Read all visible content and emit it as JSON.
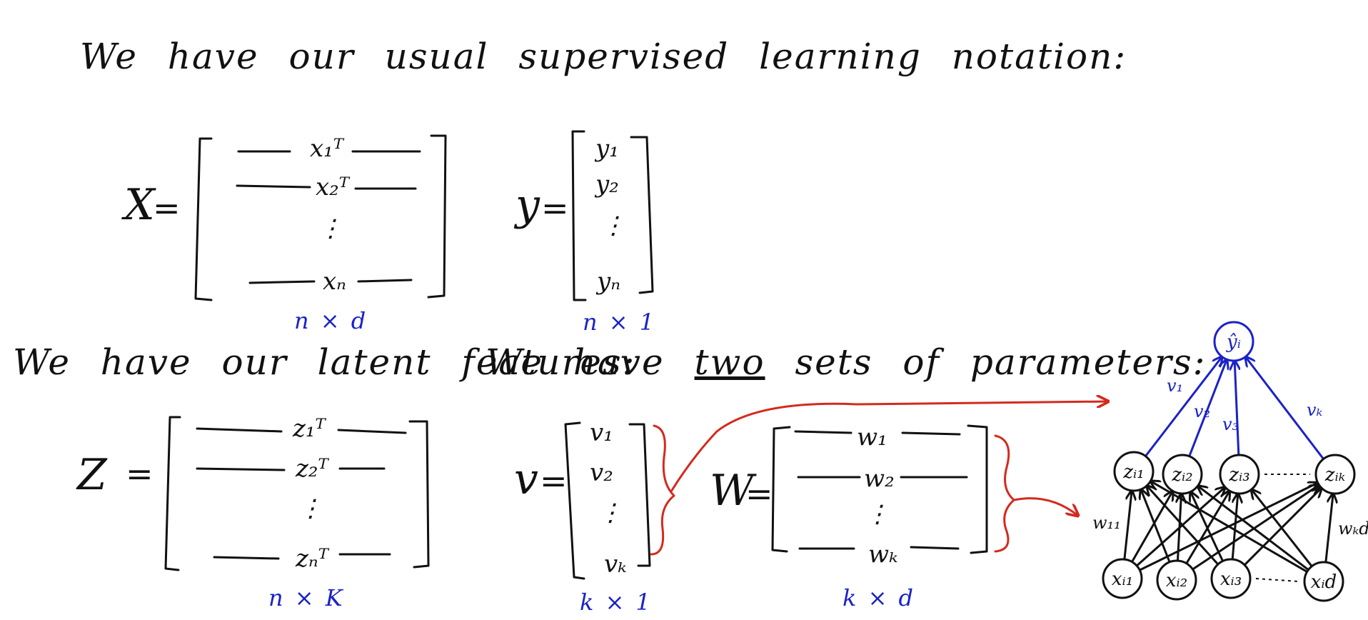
{
  "headings": {
    "supervised": "We have our usual supervised learning notation:",
    "latent": "We have our latent features:",
    "params_prefix": "We have ",
    "params_two": "two",
    "params_suffix": " sets of parameters:"
  },
  "matrix_X": {
    "symbol": "X",
    "rows": [
      "x₁ᵀ",
      "x₂ᵀ",
      "⋮",
      "xₙ"
    ],
    "dims": "n × d"
  },
  "vector_y": {
    "symbol": "y",
    "rows": [
      "y₁",
      "y₂",
      "⋮",
      "yₙ"
    ],
    "dims": "n × 1"
  },
  "matrix_Z": {
    "symbol": "Z",
    "rows": [
      "z₁ᵀ",
      "z₂ᵀ",
      "⋮",
      "zₙᵀ"
    ],
    "dims": "n × K"
  },
  "vector_v": {
    "symbol": "v",
    "rows": [
      "v₁",
      "v₂",
      "⋮",
      "vₖ"
    ],
    "dims": "k × 1"
  },
  "matrix_W": {
    "symbol": "W",
    "rows": [
      "w₁",
      "w₂",
      "⋮",
      "wₖ"
    ],
    "dims": "k × d"
  },
  "network": {
    "output_label": "ŷᵢ",
    "hidden_labels": [
      "zᵢ₁",
      "zᵢ₂",
      "zᵢ₃",
      "zᵢₖ"
    ],
    "input_labels": [
      "xᵢ₁",
      "xᵢ₂",
      "xᵢ₃",
      "xᵢd"
    ],
    "v_labels": [
      "v₁",
      "v₂",
      "v₃",
      "vₖ"
    ],
    "w_labels": [
      "w₁₁",
      "wₖd"
    ],
    "colors": {
      "output": "#1b22c6",
      "ink": "#111111",
      "annot": "#d42a1e"
    }
  }
}
